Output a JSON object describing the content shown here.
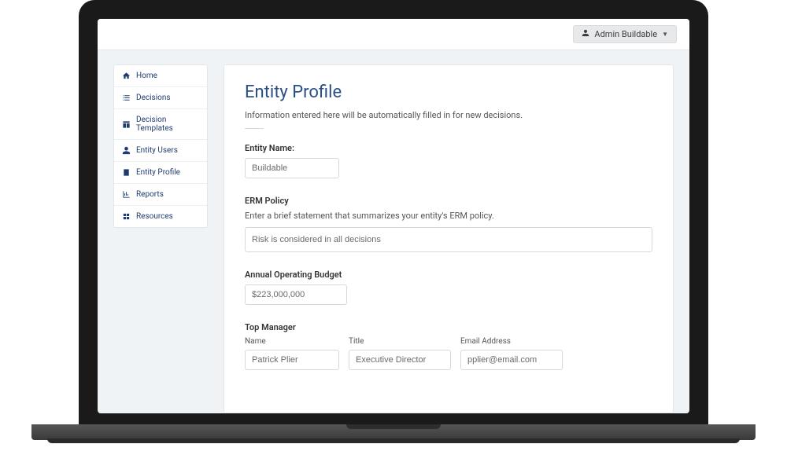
{
  "header": {
    "user_label": "Admin Buildable"
  },
  "sidebar": {
    "items": [
      {
        "label": "Home"
      },
      {
        "label": "Decisions"
      },
      {
        "label": "Decision Templates"
      },
      {
        "label": "Entity Users"
      },
      {
        "label": "Entity Profile"
      },
      {
        "label": "Reports"
      },
      {
        "label": "Resources"
      }
    ]
  },
  "page": {
    "title": "Entity Profile",
    "description": "Information entered here will be automatically filled in for new decisions."
  },
  "form": {
    "entity_name_label": "Entity Name:",
    "entity_name_value": "Buildable",
    "erm_policy_label": "ERM Policy",
    "erm_policy_sublabel": "Enter a brief statement that summarizes your entity's ERM policy.",
    "erm_policy_value": "Risk is considered in all decisions",
    "budget_label": "Annual Operating Budget",
    "budget_value": "$223,000,000",
    "top_manager_label": "Top Manager",
    "manager_name_label": "Name",
    "manager_name_value": "Patrick Plier",
    "manager_title_label": "Title",
    "manager_title_value": "Executive Director",
    "manager_email_label": "Email Address",
    "manager_email_value": "pplier@email.com"
  }
}
